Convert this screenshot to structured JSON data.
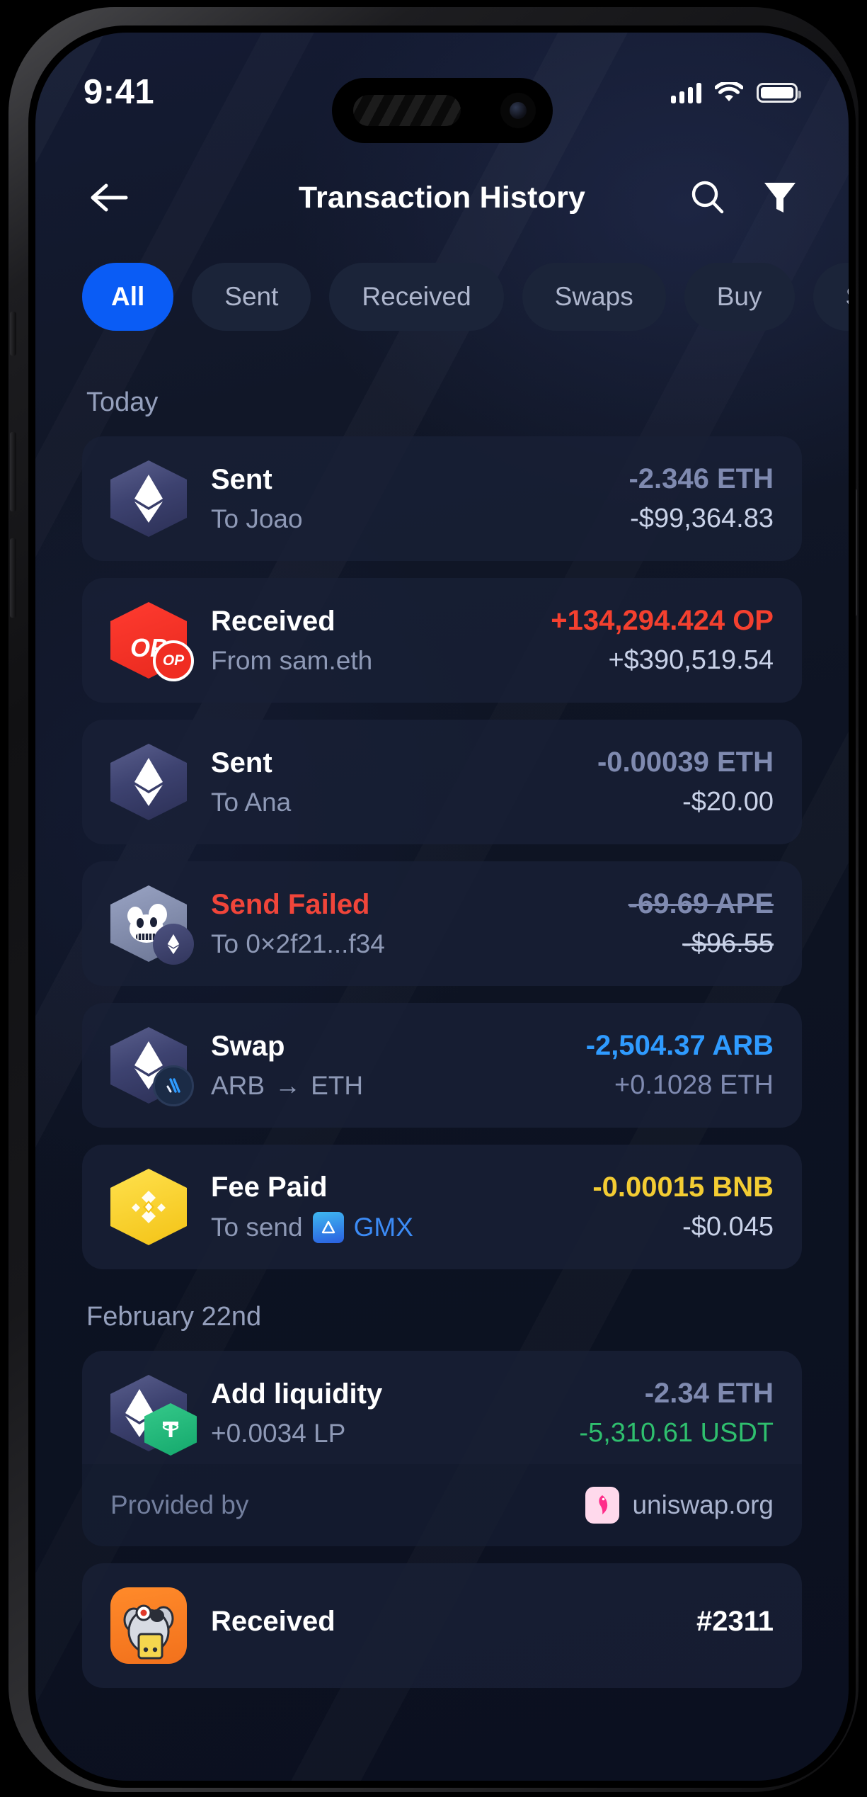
{
  "status_bar": {
    "time": "9:41",
    "icons": [
      "signal-icon",
      "wifi-icon",
      "battery-icon"
    ]
  },
  "header": {
    "back_icon": "arrow-left-icon",
    "title": "Transaction History",
    "search_icon": "search-icon",
    "filter_icon": "filter-icon"
  },
  "filters": {
    "tabs": [
      {
        "label": "All",
        "active": true
      },
      {
        "label": "Sent",
        "active": false
      },
      {
        "label": "Received",
        "active": false
      },
      {
        "label": "Swaps",
        "active": false
      },
      {
        "label": "Buy",
        "active": false
      },
      {
        "label": "Se",
        "active": false
      }
    ]
  },
  "sections": [
    {
      "label": "Today",
      "transactions": [
        {
          "icon": "ethereum-icon",
          "title": "Sent",
          "subtitle": "To Joao",
          "amount": "-2.346 ETH",
          "fiat": "-$99,364.83"
        },
        {
          "icon": "optimism-icon",
          "badge": "optimism-badge-icon",
          "title": "Received",
          "subtitle": "From sam.eth",
          "amount": "+134,294.424 OP",
          "fiat": "+$390,519.54"
        },
        {
          "icon": "ethereum-icon",
          "title": "Sent",
          "subtitle": "To Ana",
          "amount": "-0.00039 ETH",
          "fiat": "-$20.00"
        },
        {
          "icon": "apecoin-icon",
          "badge": "ethereum-badge-icon",
          "title": "Send Failed",
          "subtitle": "To 0×2f21...f34",
          "amount": "-69.69 APE",
          "fiat": "-$96.55"
        },
        {
          "icon": "ethereum-icon",
          "badge": "arbitrum-badge-icon",
          "title": "Swap",
          "subtitle_from": "ARB",
          "subtitle_arrow": "→",
          "subtitle_to": "ETH",
          "amount": "-2,504.37 ARB",
          "fiat": "+0.1028 ETH"
        },
        {
          "icon": "bnb-icon",
          "title": "Fee Paid",
          "subtitle_prefix": "To send",
          "subtitle_token_icon": "gmx-icon",
          "subtitle_token": "GMX",
          "amount": "-0.00015 BNB",
          "fiat": "-$0.045"
        }
      ]
    },
    {
      "label": "February 22nd",
      "transactions": [
        {
          "icon": "ethereum-icon",
          "badge": "tether-badge-icon",
          "title": "Add liquidity",
          "subtitle": "+0.0034 LP",
          "amount": "-2.34 ETH",
          "fiat": "-5,310.61 USDT",
          "footer_label": "Provided by",
          "footer_icon": "uniswap-icon",
          "footer_link": "uniswap.org"
        },
        {
          "icon": "nft-avatar-icon",
          "title": "Received",
          "amount": "#2311"
        }
      ]
    }
  ],
  "colors": {
    "accent": "#0a5cf5",
    "background": "#0d1322",
    "card": "#182036",
    "red": "#f4402f",
    "blue": "#2f9bff",
    "yellow": "#f3cc33",
    "green": "#2fbf6e",
    "link": "#3c8bf5"
  }
}
